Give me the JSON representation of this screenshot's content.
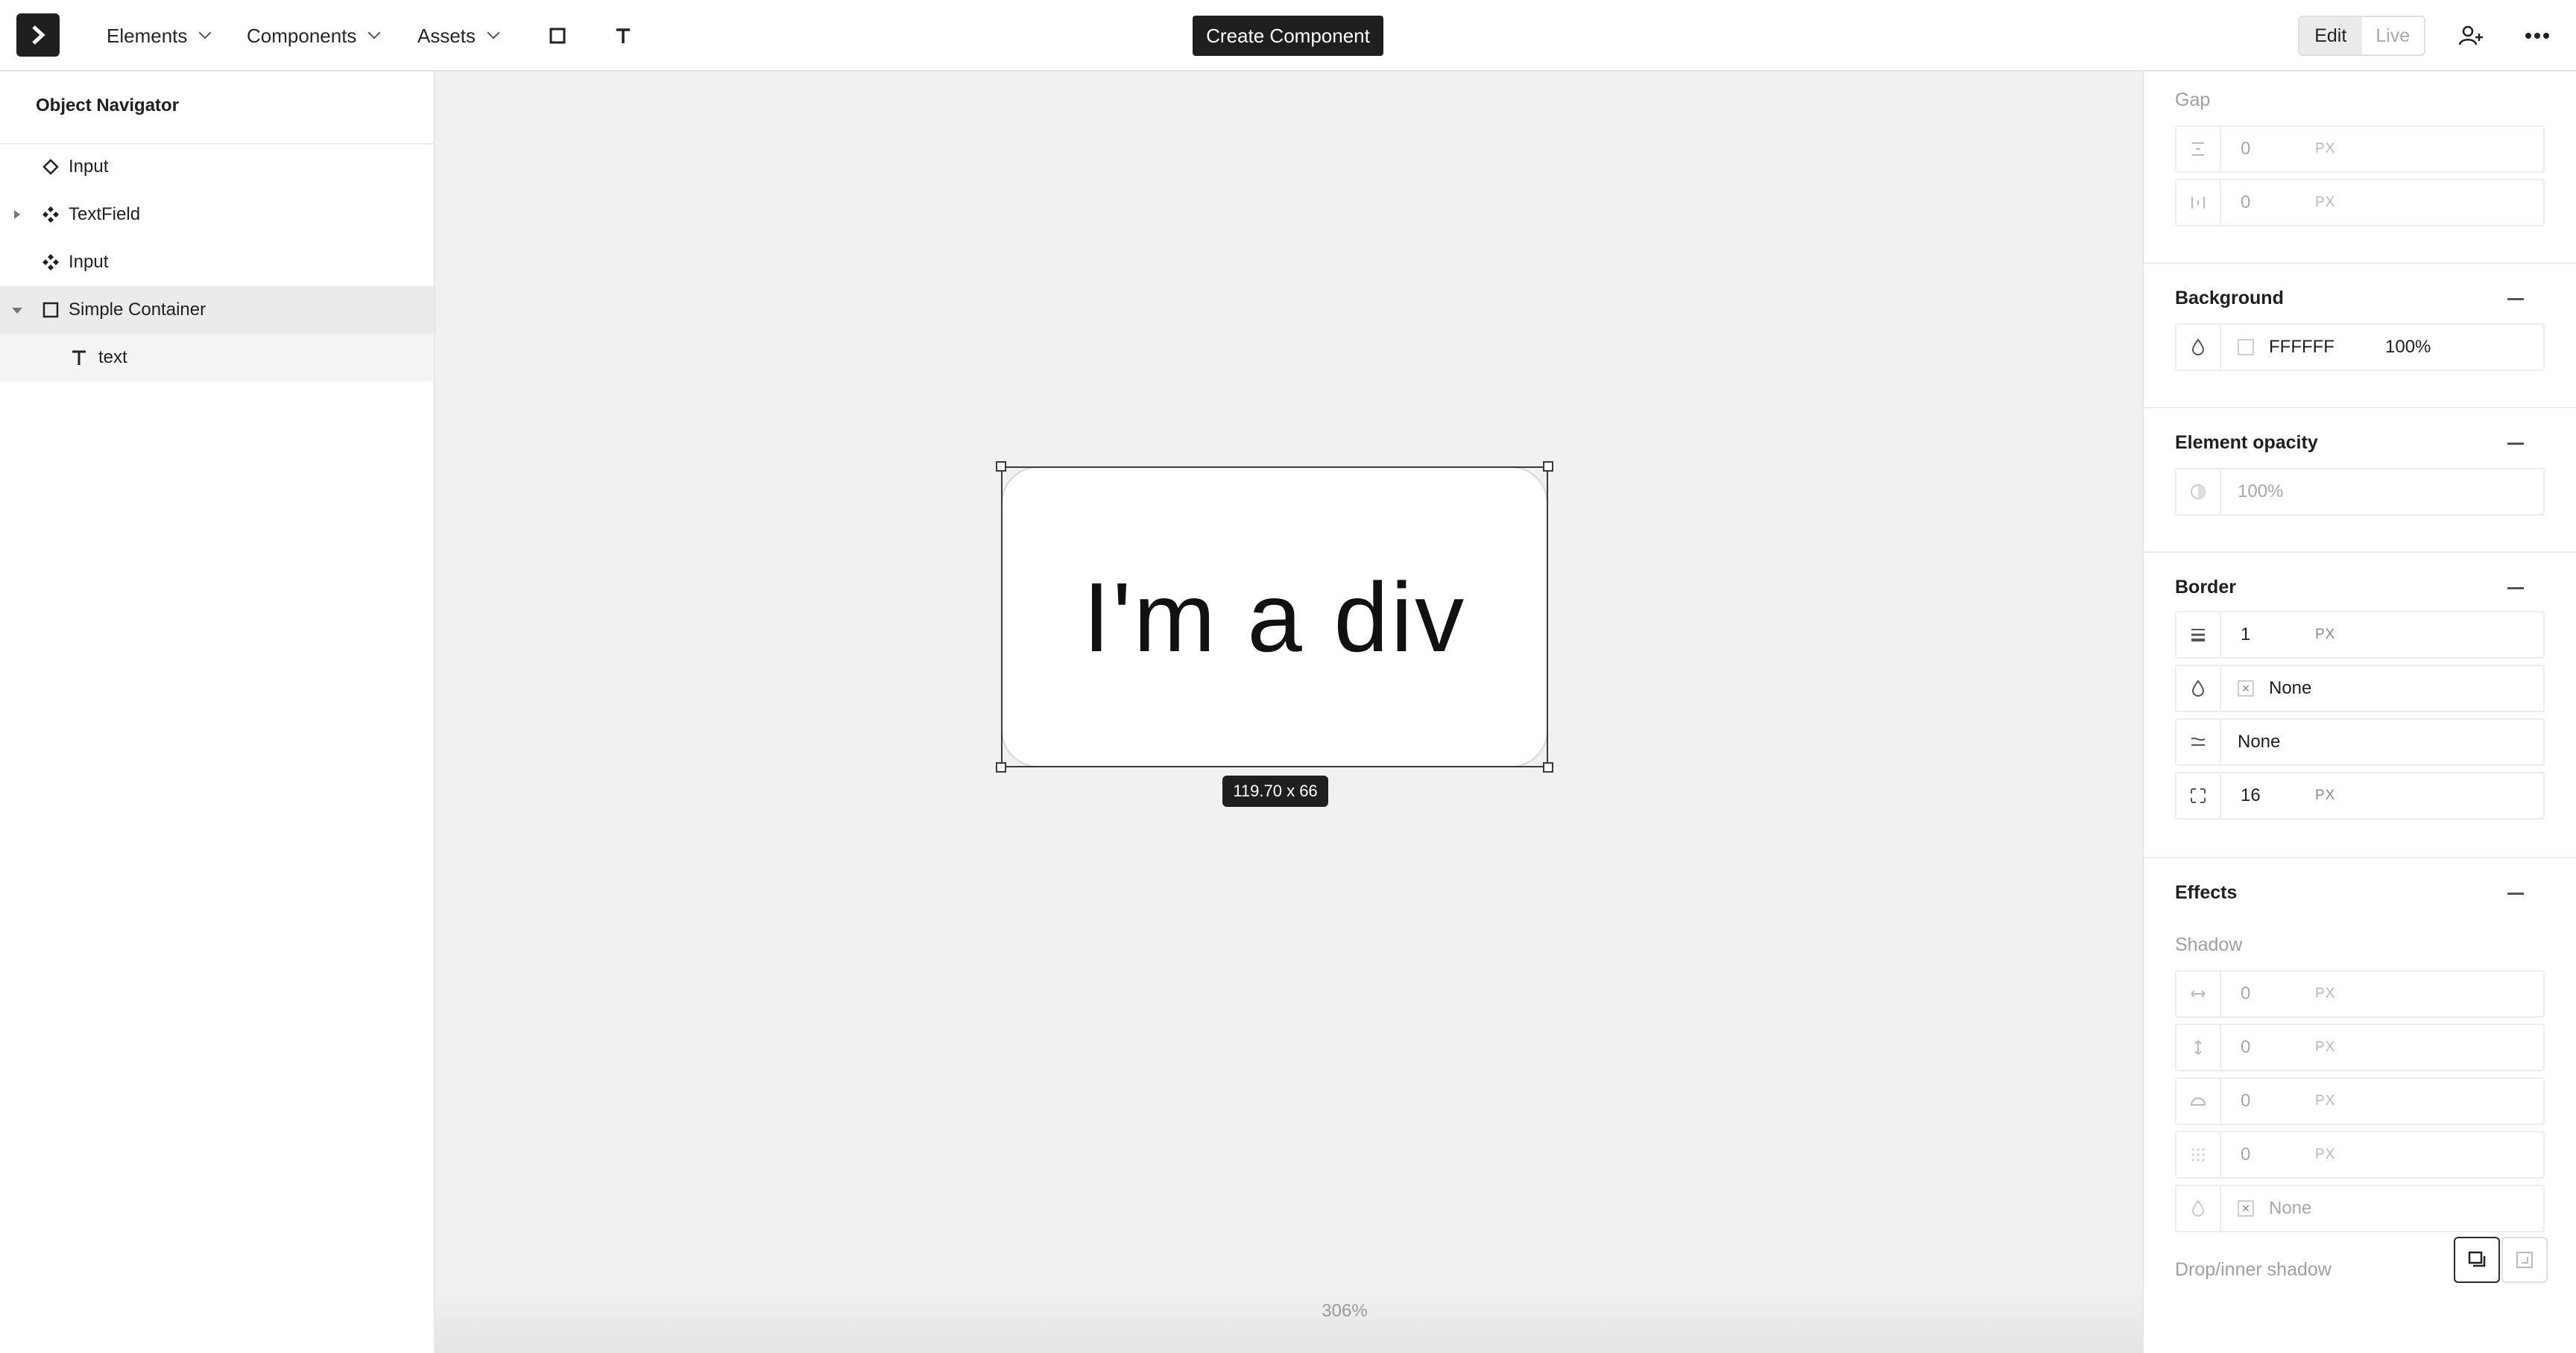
{
  "topbar": {
    "menu": [
      {
        "label": "Elements"
      },
      {
        "label": "Components"
      },
      {
        "label": "Assets"
      }
    ],
    "create_button": "Create Component",
    "mode_edit": "Edit",
    "mode_live": "Live"
  },
  "navigator": {
    "title": "Object Navigator",
    "items": [
      {
        "label": "Input",
        "icon": "diamond-icon"
      },
      {
        "label": "TextField",
        "icon": "component-icon"
      },
      {
        "label": "Input",
        "icon": "component-icon"
      },
      {
        "label": "Simple Container",
        "icon": "square-icon"
      },
      {
        "label": "text",
        "icon": "text-icon"
      }
    ]
  },
  "canvas": {
    "element_text": "I'm a div",
    "size_badge": "119.70 x 66",
    "zoom": "306%"
  },
  "properties": {
    "gap": {
      "title": "Gap",
      "row_gap": "0",
      "col_gap": "0",
      "unit": "PX"
    },
    "background": {
      "title": "Background",
      "color": "FFFFFF",
      "opacity": "100%"
    },
    "element_opacity": {
      "title": "Element opacity",
      "value": "100%"
    },
    "border": {
      "title": "Border",
      "width": "1",
      "unit": "PX",
      "color": "None",
      "style": "None",
      "radius": "16"
    },
    "effects": {
      "title": "Effects",
      "shadow_label": "Shadow",
      "x": "0",
      "y": "0",
      "blur": "0",
      "spread": "0",
      "color": "None",
      "unit": "PX",
      "drop_inner_label": "Drop/inner shadow"
    }
  }
}
